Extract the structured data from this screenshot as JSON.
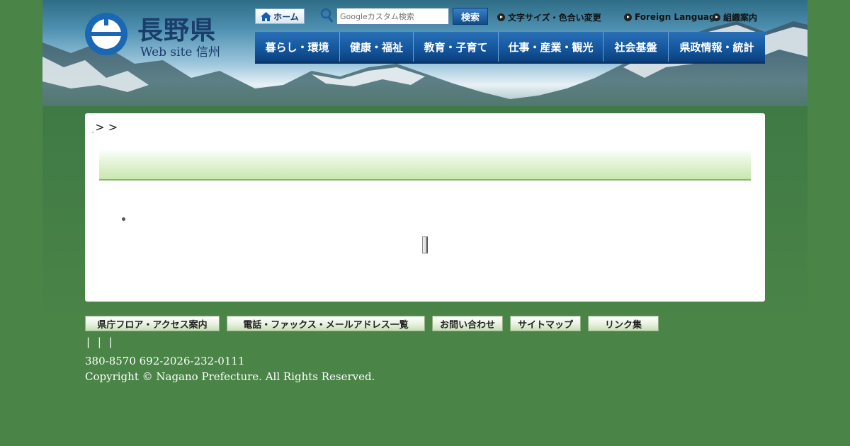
{
  "header": {
    "logo_title": "長野県",
    "logo_subtitle": "Web site 信州",
    "home_label": "ホーム",
    "search_placeholder": "Googleカスタム検索",
    "search_button": "検索",
    "util_links": [
      "文字サイズ・色合い変更",
      "Foreign Language",
      "組織案内"
    ]
  },
  "nav": {
    "items": [
      "暮らし・環境",
      "健康・福祉",
      "教育・子育て",
      "仕事・産業・観光",
      "社会基盤",
      "県政情報・統計"
    ]
  },
  "content": {
    "breadcrumb": "> >",
    "breadcrumb_marks": [
      ",",
      ","
    ]
  },
  "footer": {
    "buttons": [
      "県庁フロア・アクセス案内",
      "電話・ファックス・メールアドレス一覧",
      "お問い合わせ",
      "サイトマップ",
      "リンク集"
    ],
    "separators": "| | |",
    "address": "380-8570 692-2026-232-0111",
    "copyright": "Copyright © Nagano Prefecture. All Rights Reserved."
  },
  "colors": {
    "page_bg": "#4a8447",
    "nav_bg": "#1458a0",
    "brand_text": "#1a3d6a",
    "title_bar_green": "#c9e7ae"
  },
  "icons": [
    "nagano-logo-icon",
    "home-icon",
    "search-icon",
    "arrow-bullet-icon"
  ]
}
